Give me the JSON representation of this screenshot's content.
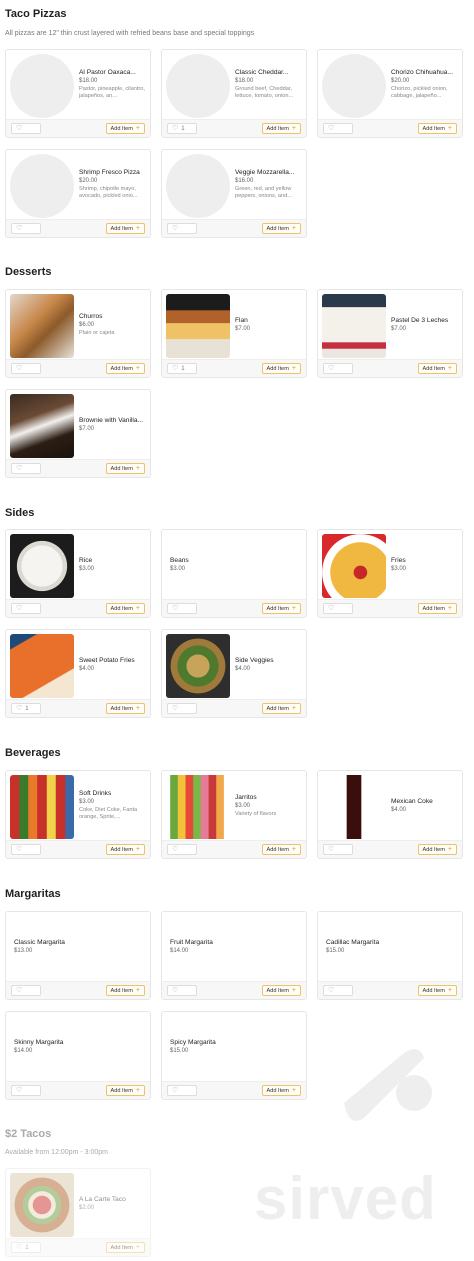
{
  "ui": {
    "add_item_label": "Add Item",
    "heart_icon": "heart-icon",
    "plus_icon": "plus-icon"
  },
  "sections": {
    "taco_pizzas": {
      "title": "Taco Pizzas",
      "subtitle": "All pizzas are 12\" thin crust layered with refried beans base and special toppings",
      "items": [
        {
          "name": "Al Pastor Oaxaca...",
          "price": "$18.00",
          "desc": "Pastor, pineapple, cilantro, jalapeños, an...",
          "likes": ""
        },
        {
          "name": "Classic Cheddar...",
          "price": "$18.00",
          "desc": "Ground beef, Cheddar, lettuce, tomato, onion...",
          "likes": "1"
        },
        {
          "name": "Chorizo Chihuahua...",
          "price": "$20.00",
          "desc": "Chorizo, pickled onion, cabbage, jalapeño...",
          "likes": ""
        },
        {
          "name": "Shrimp Fresco Pizza",
          "price": "$20.00",
          "desc": "Shrimp, chipotle mayo, avocado, pickled onio...",
          "likes": ""
        },
        {
          "name": "Veggie Mozzarella...",
          "price": "$16.00",
          "desc": "Green, red, and yellow peppers, onions, and...",
          "likes": ""
        }
      ]
    },
    "desserts": {
      "title": "Desserts",
      "items": [
        {
          "name": "Churros",
          "price": "$6.00",
          "desc": "Plain or cajeta",
          "likes": ""
        },
        {
          "name": "Flan",
          "price": "$7.00",
          "desc": "",
          "likes": "1"
        },
        {
          "name": "Pastel De 3 Leches",
          "price": "$7.00",
          "desc": "",
          "likes": ""
        },
        {
          "name": "Brownie with Vanilla...",
          "price": "$7.00",
          "desc": "",
          "likes": ""
        }
      ]
    },
    "sides": {
      "title": "Sides",
      "items": [
        {
          "name": "Rice",
          "price": "$3.00",
          "desc": "",
          "likes": ""
        },
        {
          "name": "Beans",
          "price": "$3.00",
          "desc": "",
          "likes": ""
        },
        {
          "name": "Fries",
          "price": "$3.00",
          "desc": "",
          "likes": ""
        },
        {
          "name": "Sweet Potato Fries",
          "price": "$4.00",
          "desc": "",
          "likes": "1"
        },
        {
          "name": "Side Veggies",
          "price": "$4.00",
          "desc": "",
          "likes": ""
        }
      ]
    },
    "beverages": {
      "title": "Beverages",
      "items": [
        {
          "name": "Soft Drinks",
          "price": "$3.00",
          "desc": "Coke, Diet Coke, Fanta orange, Sprite,...",
          "likes": ""
        },
        {
          "name": "Jarritos",
          "price": "$3.00",
          "desc": "Variety of flavors",
          "likes": ""
        },
        {
          "name": "Mexican Coke",
          "price": "$4.00",
          "desc": "",
          "likes": ""
        }
      ]
    },
    "margaritas": {
      "title": "Margaritas",
      "items": [
        {
          "name": "Classic Margarita",
          "price": "$13.00",
          "desc": "",
          "likes": ""
        },
        {
          "name": "Fruit Margarita",
          "price": "$14.00",
          "desc": "",
          "likes": ""
        },
        {
          "name": "Cadillac Margarita",
          "price": "$15.00",
          "desc": "",
          "likes": ""
        },
        {
          "name": "Skinny Margarita",
          "price": "$14.00",
          "desc": "",
          "likes": ""
        },
        {
          "name": "Spicy Margarita",
          "price": "$15.00",
          "desc": "",
          "likes": ""
        }
      ]
    },
    "two_dollar_tacos": {
      "title": "$2 Tacos",
      "subtitle": "Available from 12:00pm - 3:00pm",
      "items": [
        {
          "name": "A La Carte Taco",
          "price": "$2.00",
          "desc": "",
          "likes": "1"
        }
      ]
    }
  },
  "watermark": {
    "text": "sirved"
  },
  "colors": {
    "accent": "#e9c46a",
    "text": "#222222",
    "muted": "#888888"
  }
}
